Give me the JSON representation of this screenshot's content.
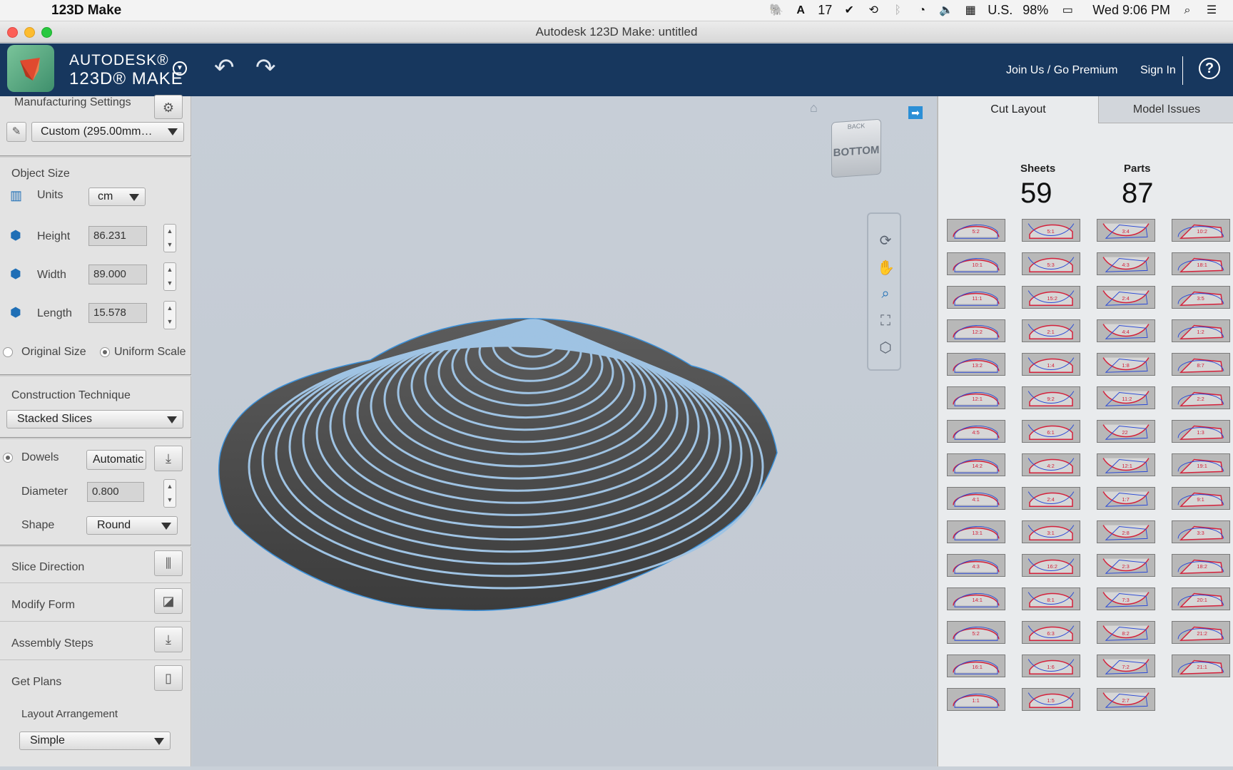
{
  "menubar": {
    "app": "123D Make",
    "status": {
      "badge": "17",
      "input_source": "U.S.",
      "battery": "98%",
      "clock": "Wed 9:06 PM"
    }
  },
  "window": {
    "title": "Autodesk 123D Make: untitled"
  },
  "header": {
    "brand_line1": "AUTODESK®",
    "brand_line2": "123D® MAKE",
    "join_label": "Join Us / Go Premium",
    "signin_label": "Sign In",
    "help_label": "?"
  },
  "left": {
    "manufacturing_title": "Manufacturing Settings",
    "material_value": "Custom (295.00mm…",
    "object_size_title": "Object Size",
    "units_label": "Units",
    "units_value": "cm",
    "height_label": "Height",
    "height_value": "86.231",
    "width_label": "Width",
    "width_value": "89.000",
    "length_label": "Length",
    "length_value": "15.578",
    "original_size_label": "Original Size",
    "uniform_scale_label": "Uniform Scale",
    "construction_title": "Construction Technique",
    "construction_value": "Stacked Slices",
    "dowels_label": "Dowels",
    "dowels_value": "Automatic",
    "diameter_label": "Diameter",
    "diameter_value": "0.800",
    "shape_label": "Shape",
    "shape_value": "Round",
    "slice_direction_label": "Slice Direction",
    "modify_form_label": "Modify Form",
    "assembly_steps_label": "Assembly Steps",
    "get_plans_label": "Get Plans",
    "layout_arrangement_label": "Layout Arrangement",
    "layout_value": "Simple"
  },
  "viewcube": {
    "top_face": "BACK",
    "front_face": "BOTTOM"
  },
  "right": {
    "tab_cut_layout": "Cut Layout",
    "tab_model_issues": "Model Issues",
    "sheets_label": "Sheets",
    "sheets_count": "59",
    "parts_label": "Parts",
    "parts_count": "87"
  },
  "sheet_labels": [
    "5:2",
    "5:1",
    "3:4",
    "10:2",
    "10:1",
    "5:3",
    "4:3",
    "18:1",
    "11:1",
    "15:2",
    "2:4",
    "3:5",
    "12:2",
    "2:1",
    "4:4",
    "1:2",
    "13:2",
    "1:4",
    "1:8",
    "8:7",
    "12:1",
    "9:2",
    "11:2",
    "2:2",
    "4:5",
    "6:1",
    "22",
    "1:3",
    "14:2",
    "4:2",
    "12:1",
    "19:1",
    "4:1",
    "2:4",
    "1:7",
    "9:1",
    "13:1",
    "3:1",
    "2:8",
    "3:3",
    "4:3",
    "16:2",
    "2:3",
    "18:2",
    "14:1",
    "8:1",
    "7:3",
    "20:1",
    "5:2",
    "6:3",
    "8:2",
    "21:2",
    "16:1",
    "1:6",
    "7:2",
    "21:1",
    "1:1",
    "1:5",
    "2:7"
  ],
  "colors": {
    "header_bg": "#17375e",
    "accent": "#2b8fd6"
  }
}
